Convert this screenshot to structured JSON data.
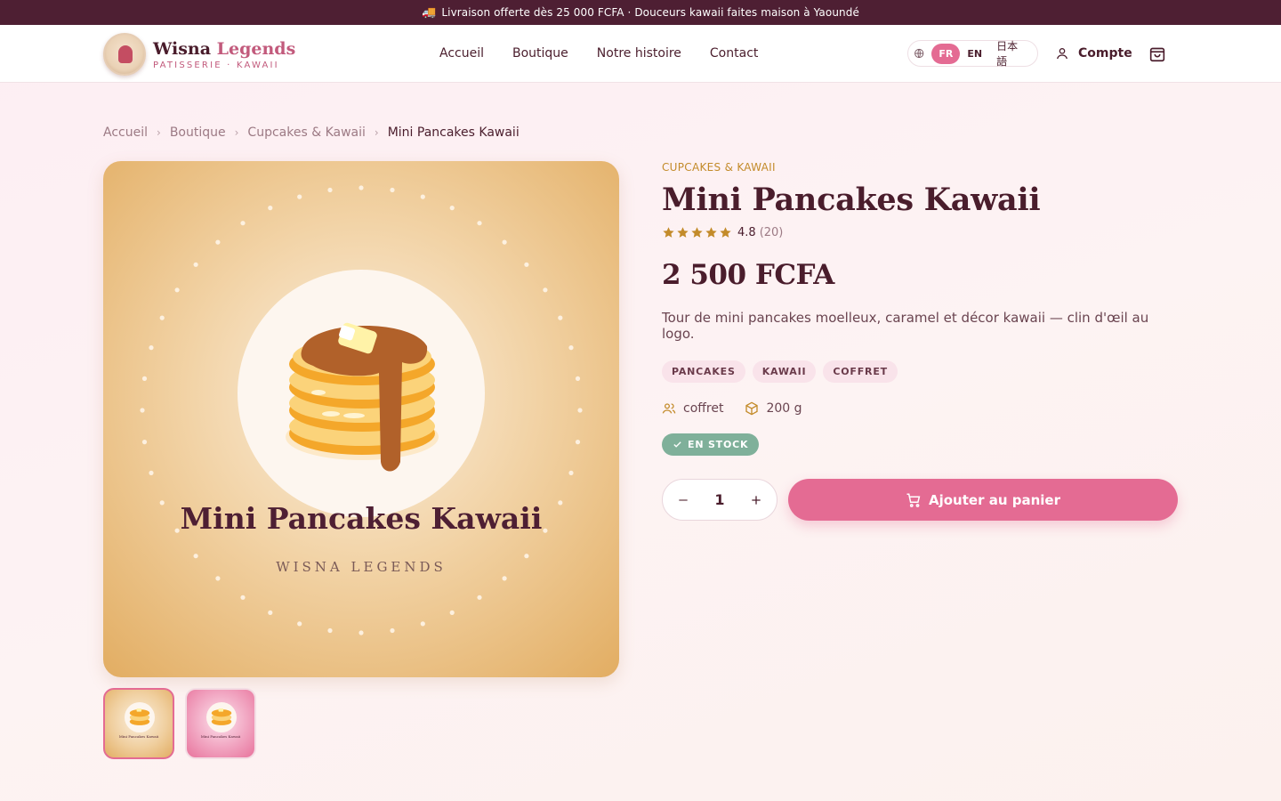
{
  "announcement": {
    "text": "Livraison offerte dès 25 000 FCFA · Douceurs kawaii faites maison à Yaoundé",
    "icon": "truck-icon"
  },
  "brand": {
    "name_part1": "Wisna",
    "name_part2": "Legends",
    "tagline": "PATISSERIE · KAWAII"
  },
  "nav": {
    "items": [
      "Accueil",
      "Boutique",
      "Notre histoire",
      "Contact"
    ]
  },
  "language": {
    "options": [
      "FR",
      "EN",
      "日本語"
    ],
    "selected": "FR"
  },
  "account": {
    "label": "Compte"
  },
  "breadcrumb": [
    "Accueil",
    "Boutique",
    "Cupcakes & Kawaii",
    "Mini Pancakes Kawaii"
  ],
  "product": {
    "category": "CUPCAKES & KAWAII",
    "title": "Mini Pancakes Kawaii",
    "rating": "4.8",
    "rating_stars": 5,
    "review_count": "(20)",
    "price": "2 500 FCFA",
    "description": "Tour de mini pancakes moelleux, caramel et décor kawaii — clin d'œil au logo.",
    "tags": [
      "PANCAKES",
      "KAWAII",
      "COFFRET"
    ],
    "serving": "coffret",
    "weight": "200 g",
    "stock": "EN STOCK",
    "quantity": "1",
    "add_to_cart": "Ajouter au panier",
    "image_caption": "Mini Pancakes Kawaii",
    "image_brand": "WISNA LEGENDS",
    "thumb_caption": "Mini Pancakes Kawaii"
  },
  "colors": {
    "primary": "#e46b93",
    "dark": "#4e1f33",
    "gold": "#c38b2a",
    "stock": "#7fb09a"
  }
}
